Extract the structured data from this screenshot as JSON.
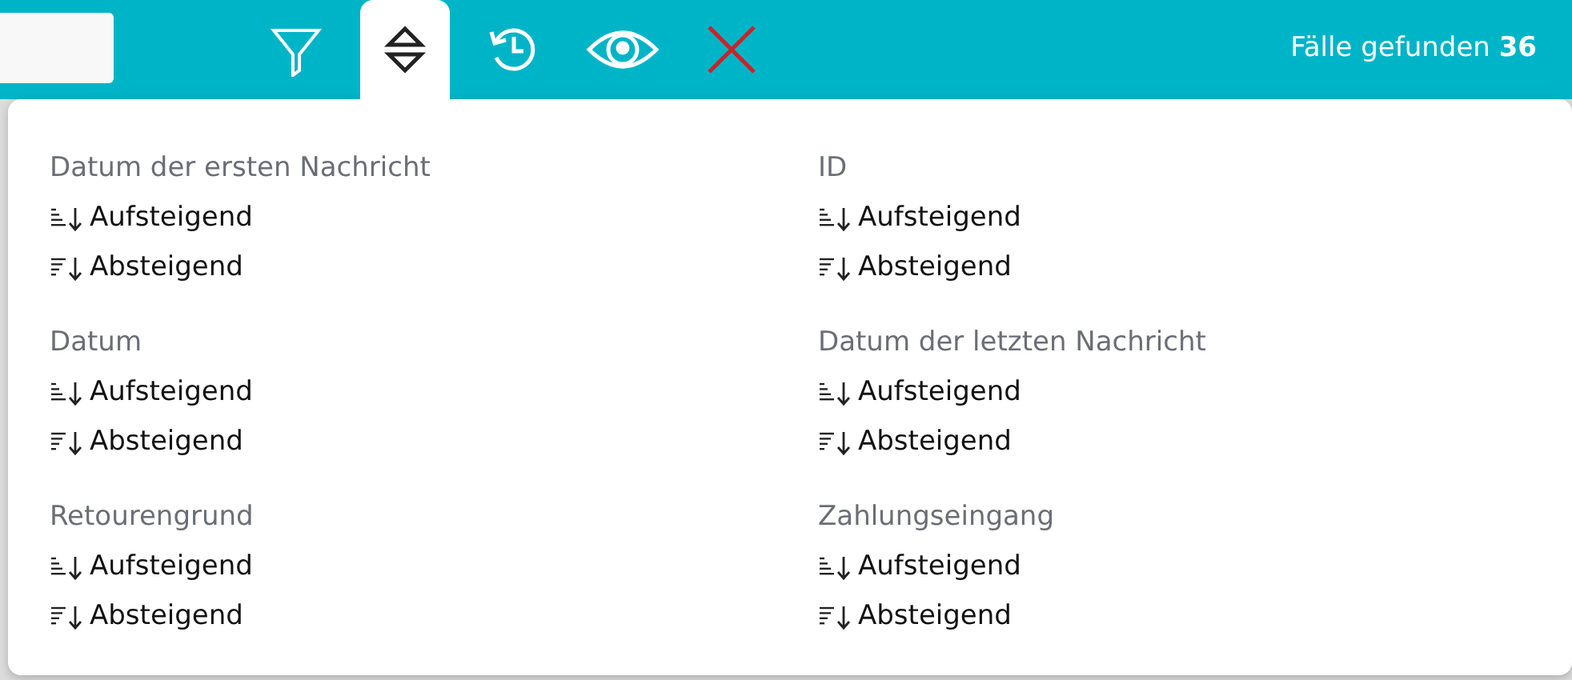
{
  "toolbar": {
    "tools": [
      {
        "kind": "filter",
        "selected": false
      },
      {
        "kind": "sort",
        "selected": true
      },
      {
        "kind": "history",
        "selected": false
      },
      {
        "kind": "view",
        "selected": false
      },
      {
        "kind": "clear",
        "selected": false
      }
    ],
    "result_count": "Fälle gefunden **36**"
  },
  "sort_groups": [
    {
      "title": "Datum der ersten Nachricht",
      "options": [
        {
          "kind": "ascending",
          "label": "Aufsteigend"
        },
        {
          "kind": "descending",
          "label": "Absteigend"
        }
      ]
    },
    {
      "title": "ID",
      "options": [
        {
          "kind": "ascending",
          "label": "Aufsteigend"
        },
        {
          "kind": "descending",
          "label": "Absteigend"
        }
      ]
    },
    {
      "title": "Datum",
      "options": [
        {
          "kind": "ascending",
          "label": "Aufsteigend"
        },
        {
          "kind": "descending",
          "label": "Absteigend"
        }
      ]
    },
    {
      "title": "Datum der letzten Nachricht",
      "options": [
        {
          "kind": "ascending",
          "label": "Aufsteigend"
        },
        {
          "kind": "descending",
          "label": "Absteigend"
        }
      ]
    },
    {
      "title": "Retourengrund",
      "options": [
        {
          "kind": "ascending",
          "label": "Aufsteigend"
        },
        {
          "kind": "descending",
          "label": "Absteigend"
        }
      ]
    },
    {
      "title": "Zahlungseingang",
      "options": [
        {
          "kind": "ascending",
          "label": "Aufsteigend"
        },
        {
          "kind": "descending",
          "label": "Absteigend"
        }
      ]
    }
  ]
}
